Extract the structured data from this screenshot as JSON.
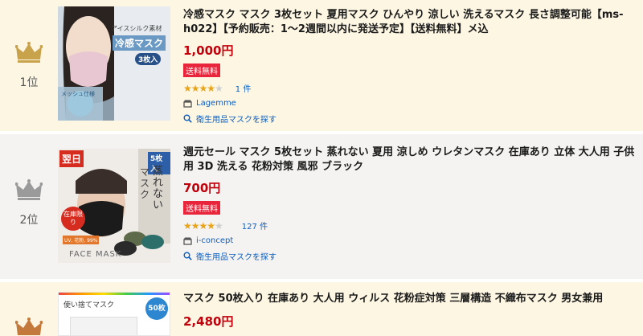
{
  "items": [
    {
      "rank": "1位",
      "title": "冷感マスク マスク 3枚セット 夏用マスク ひんやり 涼しい 洗えるマスク 長さ調整可能【ms-h022】【予約販売：1〜2週間以内に発送予定】【送料無料】メ込",
      "price": "1,000円",
      "badge": "送料無料",
      "rating": 4,
      "review_count": "1 件",
      "shop": "Lagemme",
      "search_link": "衛生用品マスクを探す",
      "image_text": {
        "line1": "アイスシルク素材",
        "line2": "冷感マスク",
        "line3": "3枚入",
        "line4": "メッシュ仕様"
      },
      "crown_color": "#c9a24c"
    },
    {
      "rank": "2位",
      "title": "週元セール マスク 5枚セット 蒸れない 夏用 涼しめ ウレタンマスク 在庫あり 立体 大人用 子供用 3D 洗える 花粉対策 風邪 ブラック",
      "price": "700円",
      "badge": "送料無料",
      "rating": 4,
      "review_count": "127 件",
      "shop": "i-concept",
      "search_link": "衛生用品マスクを探す",
      "image_text": {
        "line1": "翌日",
        "line2": "5枚入",
        "line3": "蒸れない",
        "line4": "マスク",
        "line5": "在庫限り",
        "line6": "FACE MASK",
        "line7": "UV, 花粉, 99%"
      },
      "crown_color": "#9a9a9a"
    },
    {
      "rank": "3位",
      "title": "マスク 50枚入り 在庫あり 大人用 ウィルス 花粉症対策 三層構造 不織布マスク 男女兼用",
      "price": "2,480円",
      "image_text": {
        "line1": "使い捨てマスク",
        "line2": "50枚"
      },
      "crown_color": "#c47a3c"
    }
  ]
}
